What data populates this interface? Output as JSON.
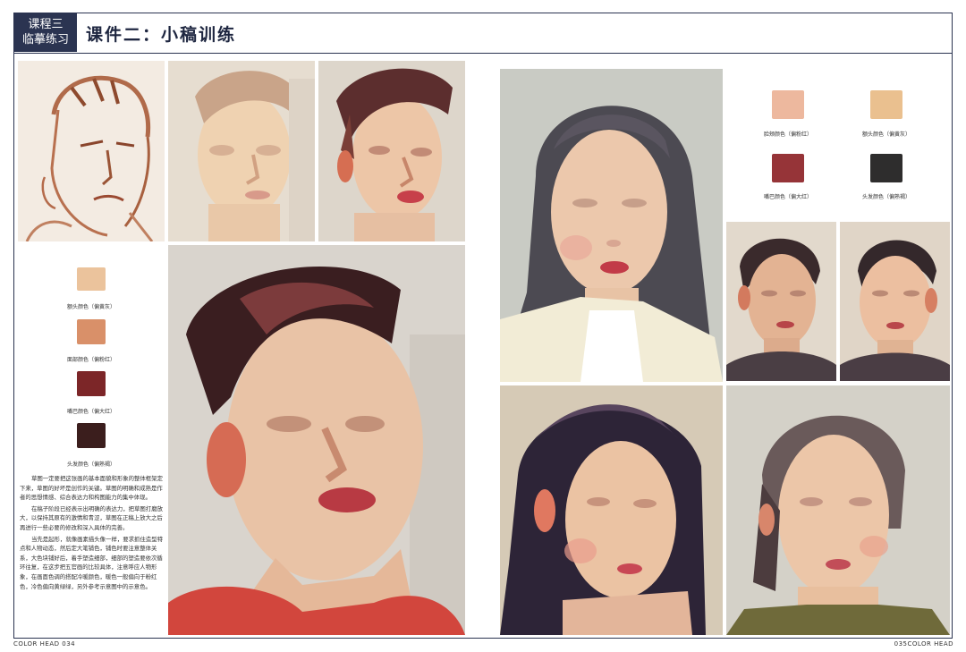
{
  "header": {
    "course_line1": "课程三",
    "course_line2": "临摹练习",
    "title": "课件二：小稿训练"
  },
  "left_swatches": [
    {
      "color": "#EBC39C",
      "label": "额头颜色（偏黄灰）"
    },
    {
      "color": "#D99069",
      "label": "面部颜色（偏粉红）"
    },
    {
      "color": "#7C2628",
      "label": "嘴巴颜色（偏大红）"
    },
    {
      "color": "#3B1E1D",
      "label": "头发颜色（偏熟褐）"
    }
  ],
  "right_swatches": [
    {
      "color": "#EDB89E",
      "label": "脸颊颜色（偏粉红）"
    },
    {
      "color": "#EAC08F",
      "label": "额头颜色（偏黄灰）"
    },
    {
      "color": "#963438",
      "label": "嘴巴颜色（偏大红）"
    },
    {
      "color": "#2E2D2D",
      "label": "头发颜色（偏熟褐）"
    }
  ],
  "body_text": [
    "草图一定要把这张画的基本面貌和形象的整体框架定下来，草图的好坏是创作的关键。草图的明确和成熟是作者的思想情感、综合表达力和构图能力的集中体现。",
    "在稿子阶段已经表示出明确的表达力，把草图打磨放大，以保持其原有的激情和青涩，草图在正稿上放大之后再进行一些必要的修改和深入具体的完善。",
    "当先是起形，就像画素描头像一样，要求抓住造型特点和人物动态，然后定大笔铺色，铺色时要注意整体关系，大色块铺好后，着手塑造细部，细部的塑造要依次循环往复，在这步把五官画的比较具体，注意呼应人物形象，在画面色调的搭配冷暖颜色，暖色一般偏向于粉红色，冷色偏向黄绿绿，另外参考示意图中的示意色。"
  ],
  "folio": {
    "left": "COLOR  HEAD   034",
    "right": "035COLOR  HEAD"
  },
  "paintings": [
    "sketch-line-portrait",
    "pale-underpainting-portrait",
    "developing-portrait",
    "large-male-portrait",
    "girl-long-hair-portrait",
    "small-man-portrait-left",
    "small-man-portrait-right",
    "girl-dark-hair-portrait",
    "woman-ponytail-portrait"
  ]
}
